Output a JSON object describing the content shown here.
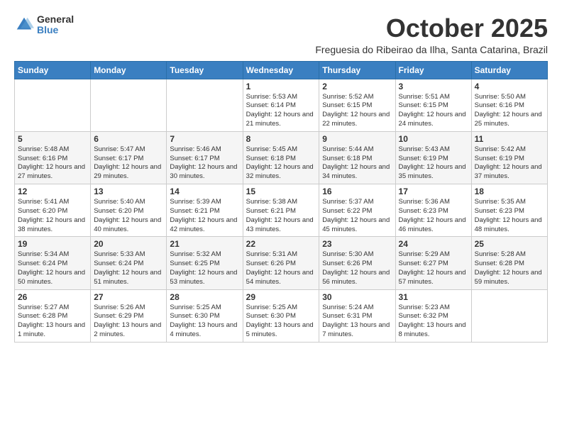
{
  "logo": {
    "general": "General",
    "blue": "Blue"
  },
  "title": "October 2025",
  "subtitle": "Freguesia do Ribeirao da Ilha, Santa Catarina, Brazil",
  "days_of_week": [
    "Sunday",
    "Monday",
    "Tuesday",
    "Wednesday",
    "Thursday",
    "Friday",
    "Saturday"
  ],
  "weeks": [
    [
      {
        "day": "",
        "info": ""
      },
      {
        "day": "",
        "info": ""
      },
      {
        "day": "",
        "info": ""
      },
      {
        "day": "1",
        "info": "Sunrise: 5:53 AM\nSunset: 6:14 PM\nDaylight: 12 hours\nand 21 minutes."
      },
      {
        "day": "2",
        "info": "Sunrise: 5:52 AM\nSunset: 6:15 PM\nDaylight: 12 hours\nand 22 minutes."
      },
      {
        "day": "3",
        "info": "Sunrise: 5:51 AM\nSunset: 6:15 PM\nDaylight: 12 hours\nand 24 minutes."
      },
      {
        "day": "4",
        "info": "Sunrise: 5:50 AM\nSunset: 6:16 PM\nDaylight: 12 hours\nand 25 minutes."
      }
    ],
    [
      {
        "day": "5",
        "info": "Sunrise: 5:48 AM\nSunset: 6:16 PM\nDaylight: 12 hours\nand 27 minutes."
      },
      {
        "day": "6",
        "info": "Sunrise: 5:47 AM\nSunset: 6:17 PM\nDaylight: 12 hours\nand 29 minutes."
      },
      {
        "day": "7",
        "info": "Sunrise: 5:46 AM\nSunset: 6:17 PM\nDaylight: 12 hours\nand 30 minutes."
      },
      {
        "day": "8",
        "info": "Sunrise: 5:45 AM\nSunset: 6:18 PM\nDaylight: 12 hours\nand 32 minutes."
      },
      {
        "day": "9",
        "info": "Sunrise: 5:44 AM\nSunset: 6:18 PM\nDaylight: 12 hours\nand 34 minutes."
      },
      {
        "day": "10",
        "info": "Sunrise: 5:43 AM\nSunset: 6:19 PM\nDaylight: 12 hours\nand 35 minutes."
      },
      {
        "day": "11",
        "info": "Sunrise: 5:42 AM\nSunset: 6:19 PM\nDaylight: 12 hours\nand 37 minutes."
      }
    ],
    [
      {
        "day": "12",
        "info": "Sunrise: 5:41 AM\nSunset: 6:20 PM\nDaylight: 12 hours\nand 38 minutes."
      },
      {
        "day": "13",
        "info": "Sunrise: 5:40 AM\nSunset: 6:20 PM\nDaylight: 12 hours\nand 40 minutes."
      },
      {
        "day": "14",
        "info": "Sunrise: 5:39 AM\nSunset: 6:21 PM\nDaylight: 12 hours\nand 42 minutes."
      },
      {
        "day": "15",
        "info": "Sunrise: 5:38 AM\nSunset: 6:21 PM\nDaylight: 12 hours\nand 43 minutes."
      },
      {
        "day": "16",
        "info": "Sunrise: 5:37 AM\nSunset: 6:22 PM\nDaylight: 12 hours\nand 45 minutes."
      },
      {
        "day": "17",
        "info": "Sunrise: 5:36 AM\nSunset: 6:23 PM\nDaylight: 12 hours\nand 46 minutes."
      },
      {
        "day": "18",
        "info": "Sunrise: 5:35 AM\nSunset: 6:23 PM\nDaylight: 12 hours\nand 48 minutes."
      }
    ],
    [
      {
        "day": "19",
        "info": "Sunrise: 5:34 AM\nSunset: 6:24 PM\nDaylight: 12 hours\nand 50 minutes."
      },
      {
        "day": "20",
        "info": "Sunrise: 5:33 AM\nSunset: 6:24 PM\nDaylight: 12 hours\nand 51 minutes."
      },
      {
        "day": "21",
        "info": "Sunrise: 5:32 AM\nSunset: 6:25 PM\nDaylight: 12 hours\nand 53 minutes."
      },
      {
        "day": "22",
        "info": "Sunrise: 5:31 AM\nSunset: 6:26 PM\nDaylight: 12 hours\nand 54 minutes."
      },
      {
        "day": "23",
        "info": "Sunrise: 5:30 AM\nSunset: 6:26 PM\nDaylight: 12 hours\nand 56 minutes."
      },
      {
        "day": "24",
        "info": "Sunrise: 5:29 AM\nSunset: 6:27 PM\nDaylight: 12 hours\nand 57 minutes."
      },
      {
        "day": "25",
        "info": "Sunrise: 5:28 AM\nSunset: 6:28 PM\nDaylight: 12 hours\nand 59 minutes."
      }
    ],
    [
      {
        "day": "26",
        "info": "Sunrise: 5:27 AM\nSunset: 6:28 PM\nDaylight: 13 hours\nand 1 minute."
      },
      {
        "day": "27",
        "info": "Sunrise: 5:26 AM\nSunset: 6:29 PM\nDaylight: 13 hours\nand 2 minutes."
      },
      {
        "day": "28",
        "info": "Sunrise: 5:25 AM\nSunset: 6:30 PM\nDaylight: 13 hours\nand 4 minutes."
      },
      {
        "day": "29",
        "info": "Sunrise: 5:25 AM\nSunset: 6:30 PM\nDaylight: 13 hours\nand 5 minutes."
      },
      {
        "day": "30",
        "info": "Sunrise: 5:24 AM\nSunset: 6:31 PM\nDaylight: 13 hours\nand 7 minutes."
      },
      {
        "day": "31",
        "info": "Sunrise: 5:23 AM\nSunset: 6:32 PM\nDaylight: 13 hours\nand 8 minutes."
      },
      {
        "day": "",
        "info": ""
      }
    ]
  ]
}
